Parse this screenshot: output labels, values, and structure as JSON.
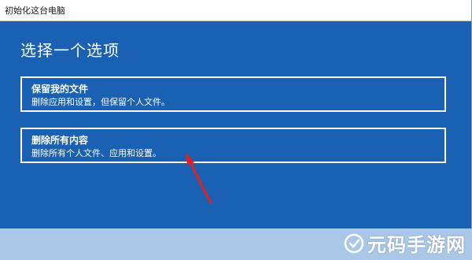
{
  "window": {
    "title": "初始化这台电脑"
  },
  "main": {
    "heading": "选择一个选项",
    "options": [
      {
        "title": "保留我的文件",
        "description": "删除应用和设置，但保留个人文件。"
      },
      {
        "title": "删除所有内容",
        "description": "删除所有个人文件、应用和设置。"
      }
    ]
  },
  "annotation": {
    "arrow_color": "#e02020"
  },
  "watermark": {
    "text": "元码手游网"
  },
  "colors": {
    "dialog_background": "#1a60b3",
    "page_background": "#a9c8e7",
    "option_border": "#ffffff"
  }
}
